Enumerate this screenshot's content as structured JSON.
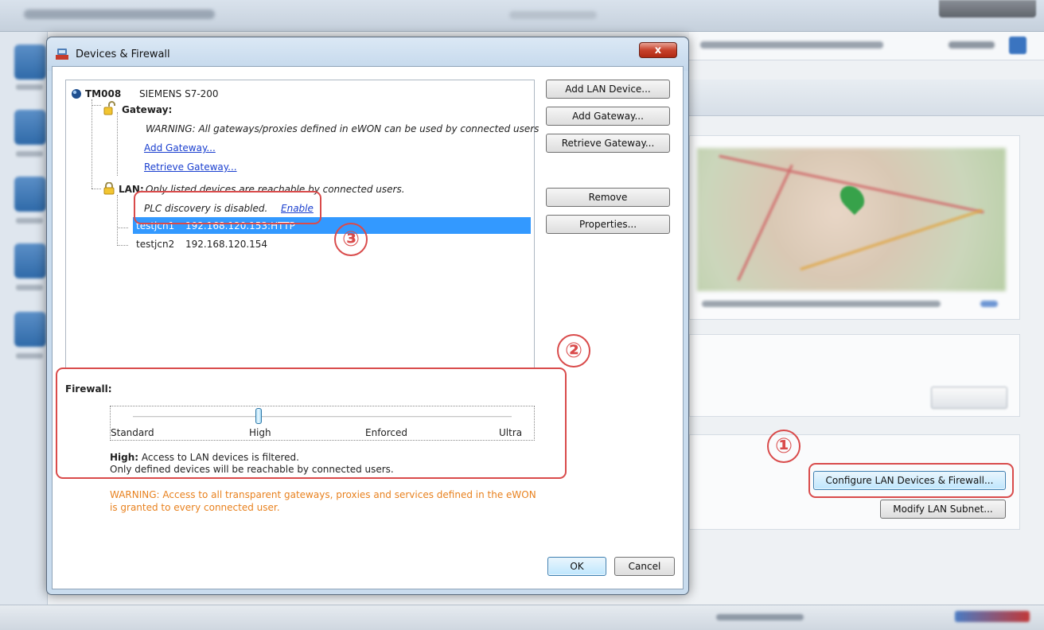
{
  "dialog": {
    "title": "Devices & Firewall",
    "close_label": "x"
  },
  "tree": {
    "device_name": "TM008",
    "device_type": "SIEMENS S7-200",
    "gateway_label": "Gateway:",
    "gateway_warning": "WARNING: All gateways/proxies defined in eWON can be used by connected users",
    "add_gateway_link": "Add Gateway...",
    "retrieve_gateway_link": "Retrieve Gateway...",
    "lan_label": "LAN:",
    "lan_note": "Only listed devices are reachable by connected users.",
    "plc_discovery_text": "PLC discovery is disabled.",
    "enable_link": "Enable",
    "devices": [
      {
        "name": "testjcn1",
        "ip": "192.168.120.153:HTTP"
      },
      {
        "name": "testjcn2",
        "ip": "192.168.120.154"
      }
    ]
  },
  "buttons": {
    "add_lan_device": "Add LAN Device...",
    "add_gateway": "Add Gateway...",
    "retrieve_gateway": "Retrieve Gateway...",
    "remove": "Remove",
    "properties": "Properties...",
    "ok": "OK",
    "cancel": "Cancel"
  },
  "firewall": {
    "label": "Firewall:",
    "levels": [
      "Standard",
      "High",
      "Enforced",
      "Ultra"
    ],
    "selected_level": "High",
    "desc_title": "High:",
    "desc_line1": "Access to LAN devices is filtered.",
    "desc_line2": "Only defined devices will be reachable by connected users.",
    "warning_line1": "WARNING: Access to all transparent gateways, proxies and services defined in the eWON",
    "warning_line2": "is granted to every connected user."
  },
  "background": {
    "configure_button": "Configure LAN Devices & Firewall...",
    "modify_subnet_button": "Modify LAN Subnet..."
  },
  "annotations": [
    "①",
    "②",
    "③"
  ],
  "colors": {
    "annotation": "#d94b4b",
    "warning_text": "#e8811e",
    "selection": "#3399ff",
    "link": "#1a3fcf"
  }
}
